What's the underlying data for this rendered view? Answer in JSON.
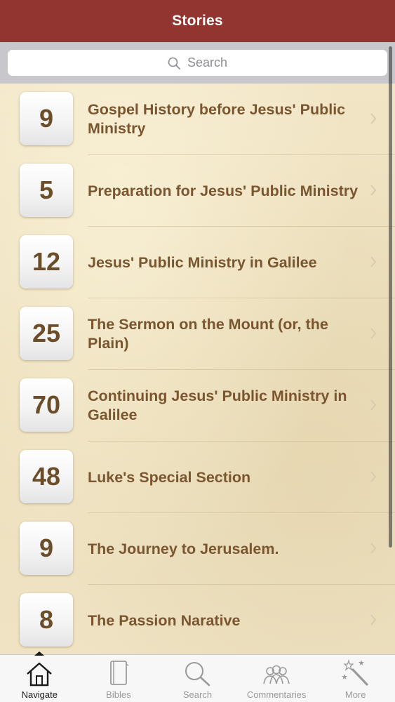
{
  "header": {
    "title": "Stories"
  },
  "search": {
    "placeholder": "Search"
  },
  "stories": [
    {
      "count": "9",
      "title": "Gospel History before Jesus' Public Ministry"
    },
    {
      "count": "5",
      "title": "Preparation for Jesus' Public Ministry"
    },
    {
      "count": "12",
      "title": "Jesus' Public Ministry in Galilee"
    },
    {
      "count": "25",
      "title": "The Sermon on the Mount (or, the Plain)"
    },
    {
      "count": "70",
      "title": "Continuing Jesus' Public Ministry in Galilee"
    },
    {
      "count": "48",
      "title": "Luke's Special Section"
    },
    {
      "count": "9",
      "title": "The Journey to Jerusalem."
    },
    {
      "count": "8",
      "title": "The Passion Narative"
    }
  ],
  "tabs": [
    {
      "label": "Navigate",
      "icon": "house-icon",
      "active": true
    },
    {
      "label": "Bibles",
      "icon": "book-icon",
      "active": false
    },
    {
      "label": "Search",
      "icon": "magnifier-icon",
      "active": false
    },
    {
      "label": "Commentaries",
      "icon": "people-icon",
      "active": false
    },
    {
      "label": "More",
      "icon": "magic-wand-icon",
      "active": false
    }
  ],
  "colors": {
    "nav_bar": "#923530",
    "row_text": "#7a5630",
    "tile_text": "#6c4d2a",
    "background": "#efe3c3"
  }
}
